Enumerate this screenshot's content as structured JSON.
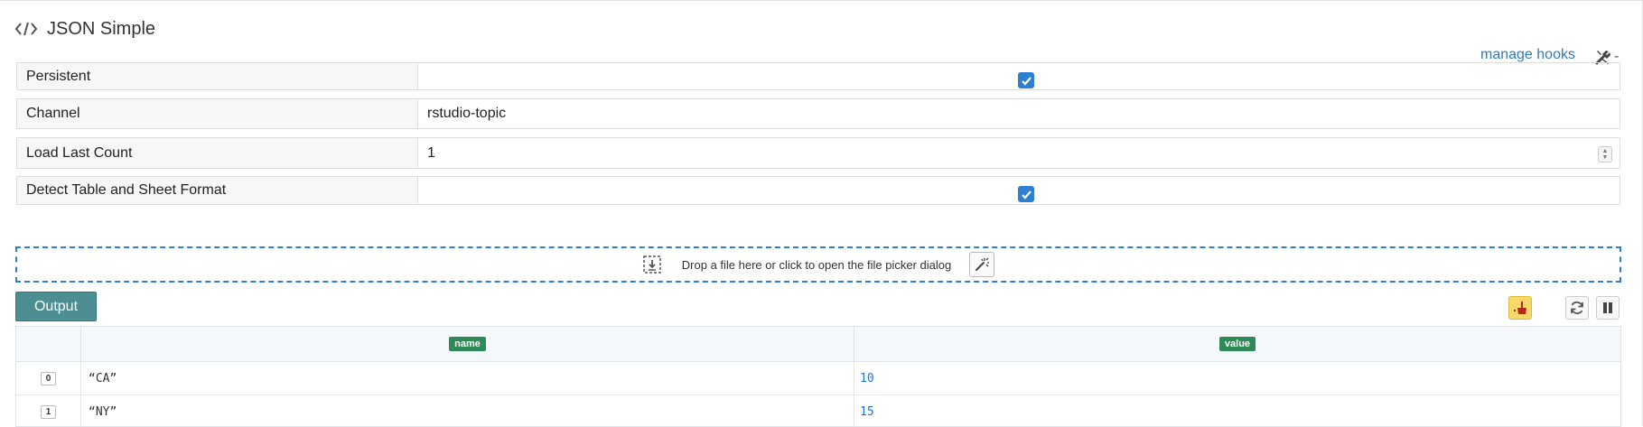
{
  "header": {
    "title": "JSON Simple",
    "title_icon": "code-icon",
    "manage_hooks": "manage hooks",
    "tools_icon": "tools-icon",
    "tools_suffix": "-"
  },
  "form": {
    "persistent": {
      "label": "Persistent",
      "checked": true
    },
    "channel": {
      "label": "Channel",
      "value": "rstudio-topic"
    },
    "load_last_count": {
      "label": "Load Last Count",
      "value": "1"
    },
    "detect_format": {
      "label": "Detect Table and Sheet Format",
      "checked": true
    }
  },
  "dropzone": {
    "text": "Drop a file here or click to open the file picker dialog",
    "icon": "file-drop-icon",
    "wand_icon": "magic-wand-icon"
  },
  "output": {
    "button_label": "Output",
    "toolbar_icons": [
      "clear-icon",
      "refresh-icon",
      "pause-icon"
    ]
  },
  "table": {
    "columns": [
      "name",
      "value"
    ],
    "rows": [
      {
        "index": "0",
        "name": "“CA”",
        "value": "10"
      },
      {
        "index": "1",
        "name": "“NY”",
        "value": "15"
      }
    ]
  },
  "colors": {
    "accent": "#2f7fd1",
    "output_button": "#4d8e92",
    "column_badge": "#2e8b57",
    "number_value": "#1a73e8",
    "clear_button": "#f6d86b"
  }
}
